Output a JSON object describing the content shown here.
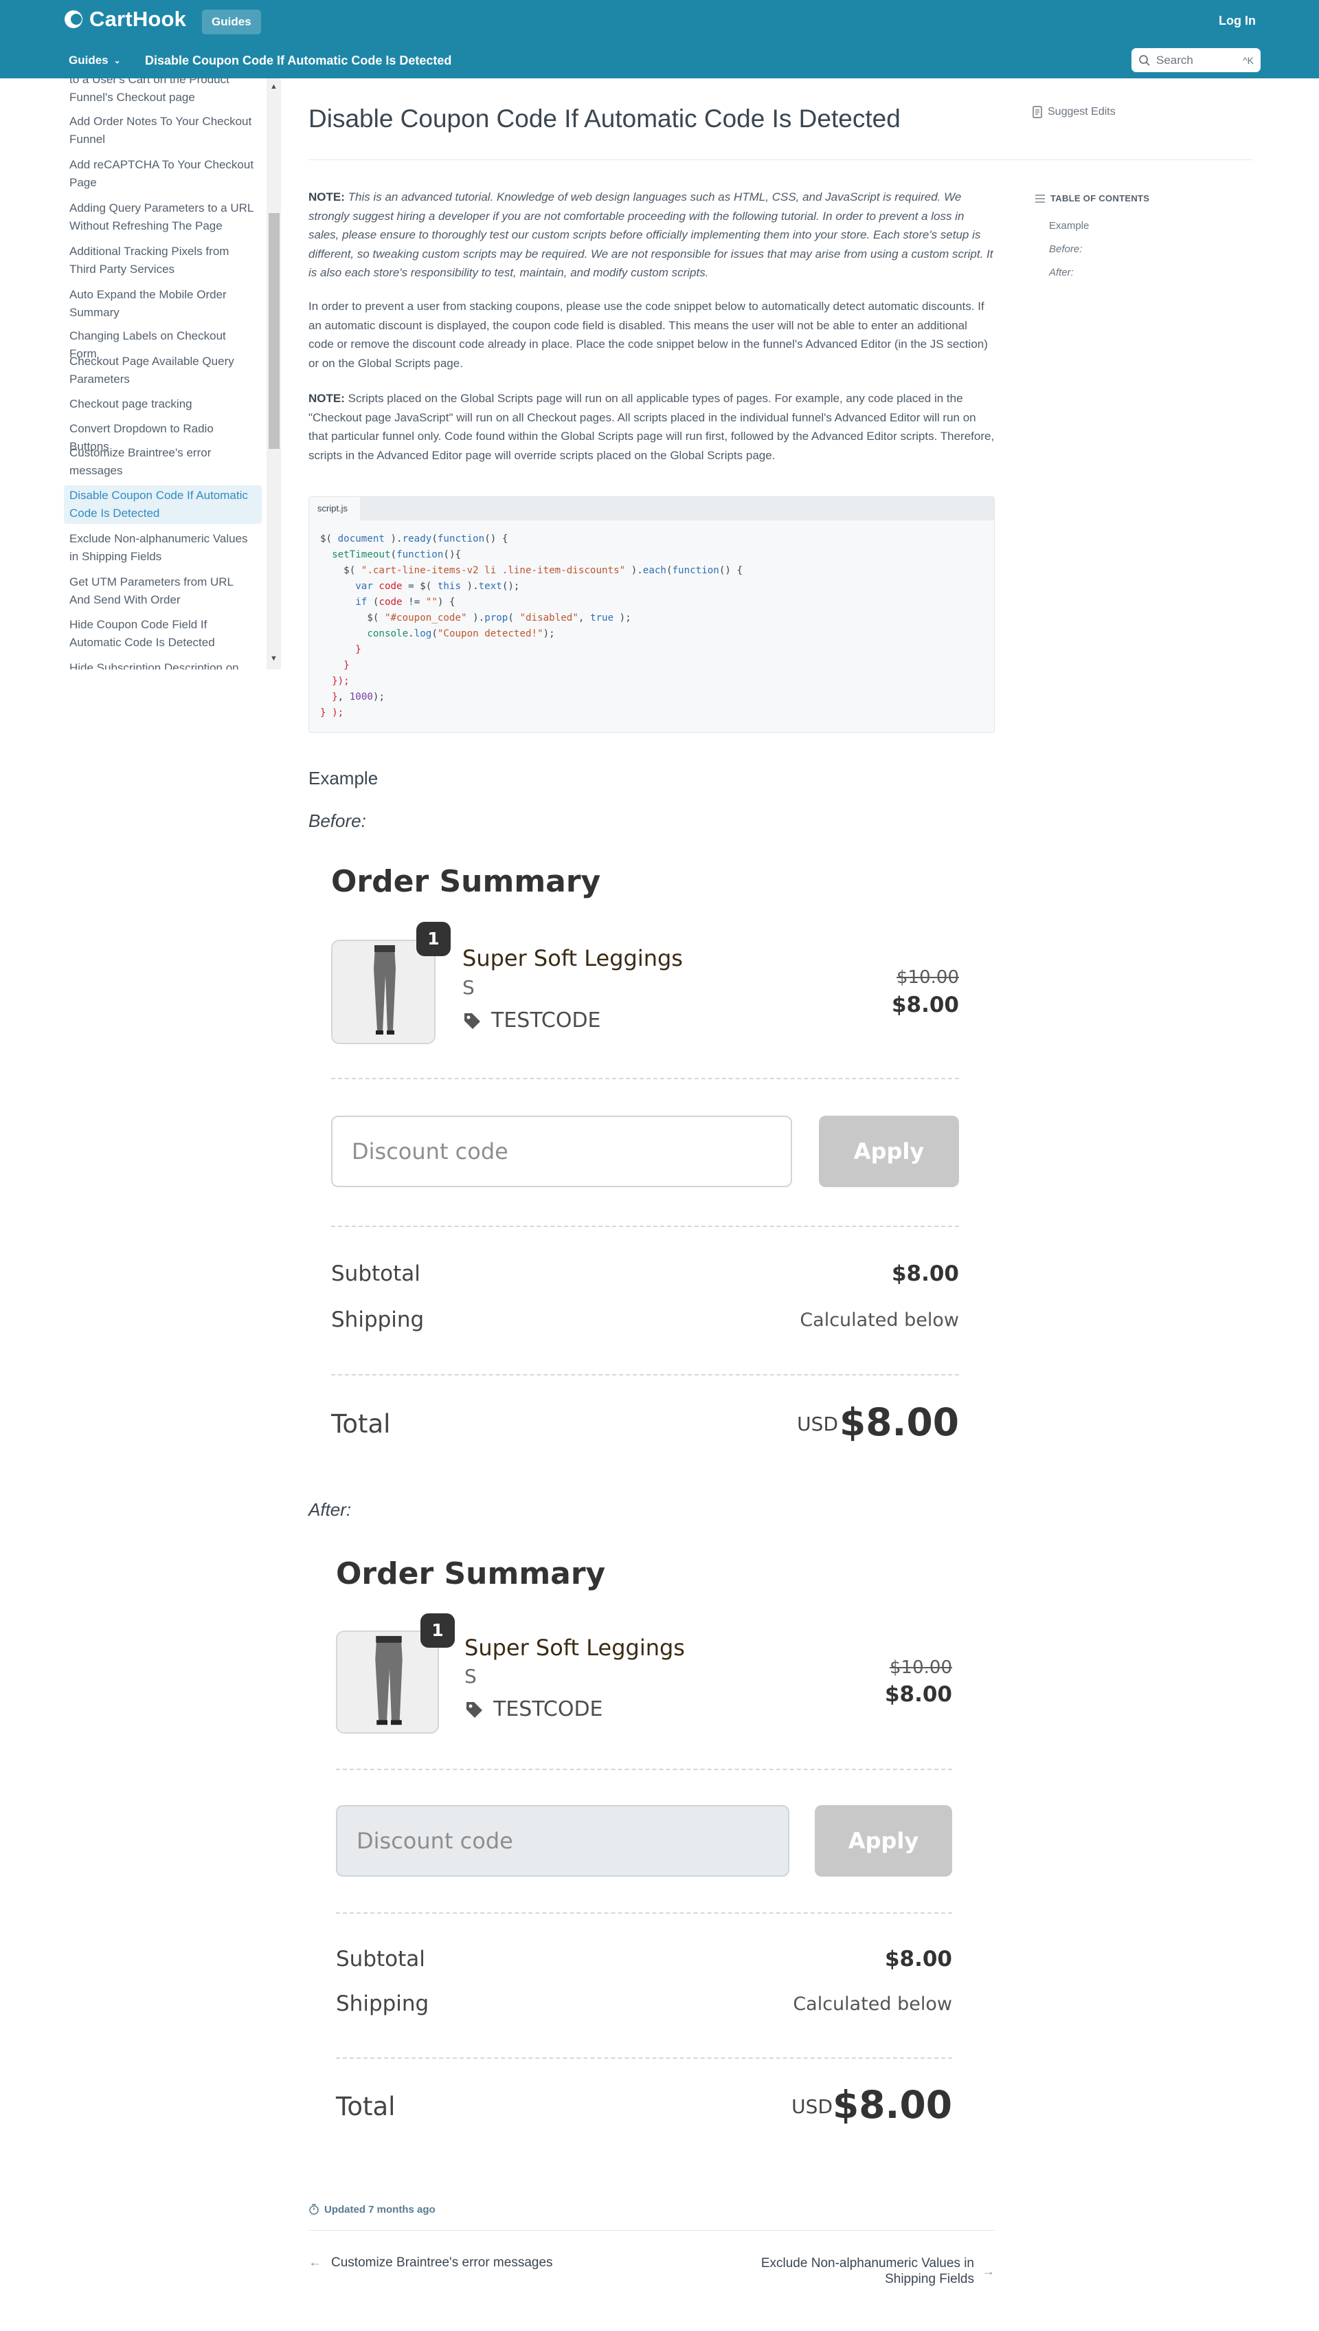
{
  "header": {
    "brand": "CartHook",
    "guides_pill": "Guides",
    "login": "Log In",
    "nav_dropdown": "Guides",
    "nav_title": "Disable Coupon Code If Automatic Code Is Detected",
    "search_placeholder": "Search",
    "search_shortcut": "^K",
    "bar_color": "#1e87a8"
  },
  "sidebar": {
    "items": [
      "to a User's Cart on the Product Funnel's Checkout page",
      "Add Order Notes To Your Checkout Funnel",
      "Add reCAPTCHA To Your Checkout Page",
      "Adding Query Parameters to a URL Without Refreshing The Page",
      "Additional Tracking Pixels from Third Party Services",
      "Auto Expand the Mobile Order Summary",
      "Changing Labels on Checkout Form",
      "Checkout Page Available Query Parameters",
      "Checkout page tracking",
      "Convert Dropdown to Radio Buttons",
      "Customize Braintree's error messages",
      "Disable Coupon Code If Automatic Code Is Detected",
      "Exclude Non-alphanumeric Values in Shipping Fields",
      "Get UTM Parameters from URL And Send With Order",
      "Hide Coupon Code Field If Automatic Code Is Detected",
      "Hide Subscription Description on"
    ],
    "active_index": 11
  },
  "article": {
    "title": "Disable Coupon Code If Automatic Code Is Detected",
    "suggest_edits": "Suggest Edits",
    "note1_label": "NOTE:",
    "note1_text": "This is an advanced tutorial. Knowledge of web design languages such as HTML, CSS, and JavaScript is required. We strongly suggest hiring a developer if you are not comfortable proceeding with the following tutorial. In order to prevent a loss in sales, please ensure to thoroughly test our custom scripts before officially implementing them into your store. Each store's setup is different, so tweaking custom scripts may be required. We are not responsible for issues that may arise from using a custom script. It is also each store's responsibility to test, maintain, and modify custom scripts.",
    "para2": "In order to prevent a user from stacking coupons, please use the code snippet below to automatically detect automatic discounts. If an automatic discount is displayed, the coupon code field is disabled. This means the user will not be able to enter an additional code or remove the discount code already in place. Place the code snippet below in the funnel's Advanced Editor (in the JS section) or on the Global Scripts page.",
    "note2_label": "NOTE:",
    "note2_text": "Scripts placed on the Global Scripts page will run on all applicable types of pages. For example, any code placed in the \"Checkout page JavaScript\" will run on all Checkout pages. All scripts placed in the individual funnel's Advanced Editor will run on that particular funnel only. Code found within the Global Scripts page will run first, followed by the Advanced Editor scripts. Therefore, scripts in the Advanced Editor page will override scripts placed on the Global Scripts page.",
    "code_tab": "script.js",
    "example_heading": "Example",
    "before_heading": "Before:",
    "after_heading": "After:"
  },
  "toc": {
    "label": "TABLE OF CONTENTS",
    "items": [
      "Example",
      "Before:",
      "After:"
    ]
  },
  "order_before": {
    "title": "Order Summary",
    "qty": "1",
    "product": "Super Soft Leggings",
    "variant": "S",
    "discount_code": "TESTCODE",
    "old_price": "$10.00",
    "new_price": "$8.00",
    "discount_placeholder": "Discount code",
    "apply": "Apply",
    "subtotal_label": "Subtotal",
    "subtotal": "$8.00",
    "shipping_label": "Shipping",
    "shipping": "Calculated below",
    "total_label": "Total",
    "currency": "USD",
    "total": "$8.00"
  },
  "order_after": {
    "title": "Order Summary",
    "qty": "1",
    "product": "Super Soft Leggings",
    "variant": "S",
    "discount_code": "TESTCODE",
    "old_price": "$10.00",
    "new_price": "$8.00",
    "discount_placeholder": "Discount code",
    "apply": "Apply",
    "subtotal_label": "Subtotal",
    "subtotal": "$8.00",
    "shipping_label": "Shipping",
    "shipping": "Calculated below",
    "total_label": "Total",
    "currency": "USD",
    "total": "$8.00"
  },
  "footer": {
    "updated": "Updated 7 months ago",
    "prev": "Customize Braintree's error messages",
    "next": "Exclude Non-alphanumeric Values in Shipping Fields"
  }
}
